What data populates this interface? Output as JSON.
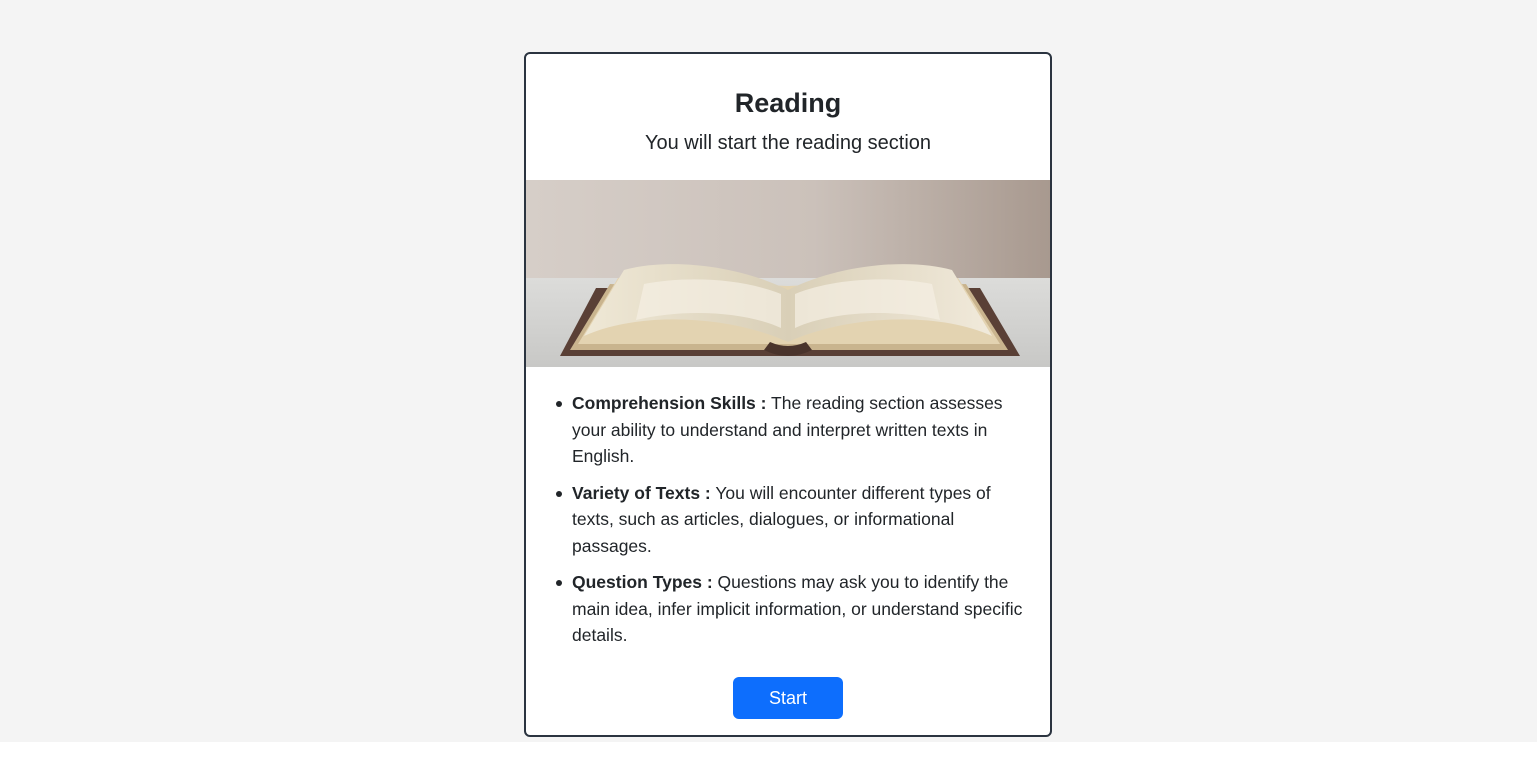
{
  "card": {
    "title": "Reading",
    "subtitle": "You will start the reading section",
    "image": {
      "alt": "open-book"
    },
    "items": [
      {
        "term": "Comprehension Skills :",
        "text": "The reading section assesses your ability to understand and interpret written texts in English."
      },
      {
        "term": "Variety of Texts :",
        "text": "You will encounter different types of texts, such as articles, dialogues, or informational passages."
      },
      {
        "term": "Question Types :",
        "text": "Questions may ask you to identify the main idea, infer implicit information, or understand specific details."
      }
    ],
    "start_label": "Start"
  },
  "colors": {
    "page_background": "#f4f4f4",
    "card_border": "#2b3440",
    "text": "#212529",
    "primary": "#0d6efd"
  }
}
